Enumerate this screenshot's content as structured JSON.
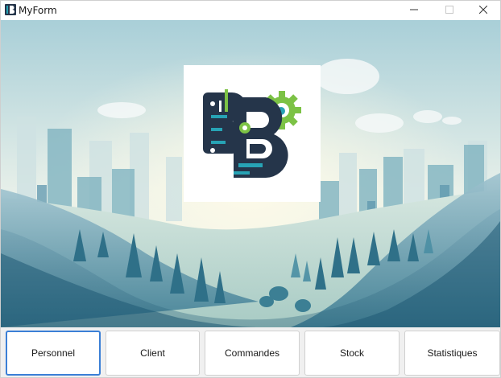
{
  "window": {
    "title": "MyForm",
    "icon": "app-logo-icon",
    "controls": [
      "minimize-icon",
      "maximize-icon",
      "close-icon"
    ]
  },
  "banner": {
    "logo": "company-logo-B-gear"
  },
  "nav": {
    "buttons": [
      {
        "label": "Personnel",
        "focused": true
      },
      {
        "label": "Client"
      },
      {
        "label": "Commandes"
      },
      {
        "label": "Stock"
      },
      {
        "label": "Statistiques"
      }
    ]
  },
  "colors": {
    "focus_border": "#3b7fd6",
    "logo_navy": "#25354a",
    "logo_teal": "#27a3b5",
    "logo_green": "#7cc245"
  }
}
